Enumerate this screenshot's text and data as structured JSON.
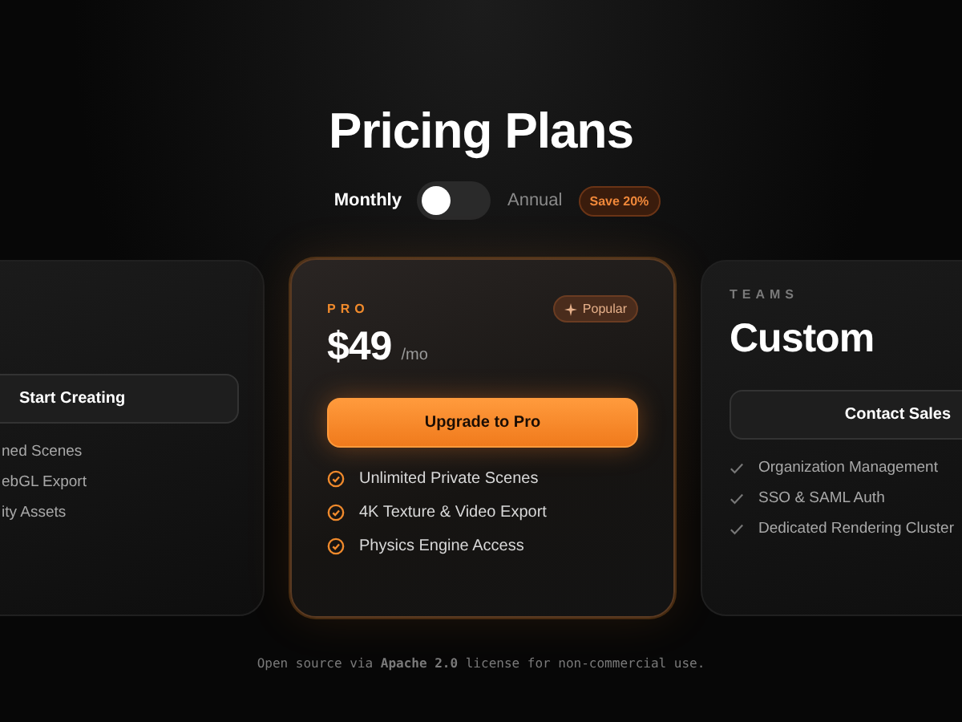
{
  "title": "Pricing Plans",
  "billing": {
    "monthly_label": "Monthly",
    "annual_label": "Annual",
    "annual_selected": false,
    "discount": "Save 20%"
  },
  "plans": [
    {
      "kind": "side",
      "button": "Start Creating",
      "features": [
        "ned Scenes",
        "ebGL Export",
        "ity Assets"
      ],
      "featured": false
    },
    {
      "kind": "featured",
      "tier": "PRO",
      "price": "$49",
      "unit": "/mo",
      "badge": "Popular",
      "button": "Upgrade to Pro",
      "features": [
        "Unlimited Private Scenes",
        "4K Texture & Video Export",
        "Physics Engine Access"
      ],
      "featured": true
    },
    {
      "kind": "side",
      "tier": "TEAMS",
      "price": "Custom",
      "button": "Contact Sales",
      "features": [
        "Organization Management",
        "SSO & SAML Auth",
        "Dedicated Rendering Cluster"
      ],
      "featured": false
    }
  ],
  "footer": {
    "before": "Open source via ",
    "bold": "Apache 2.0",
    "after": " license for non-commercial use."
  }
}
